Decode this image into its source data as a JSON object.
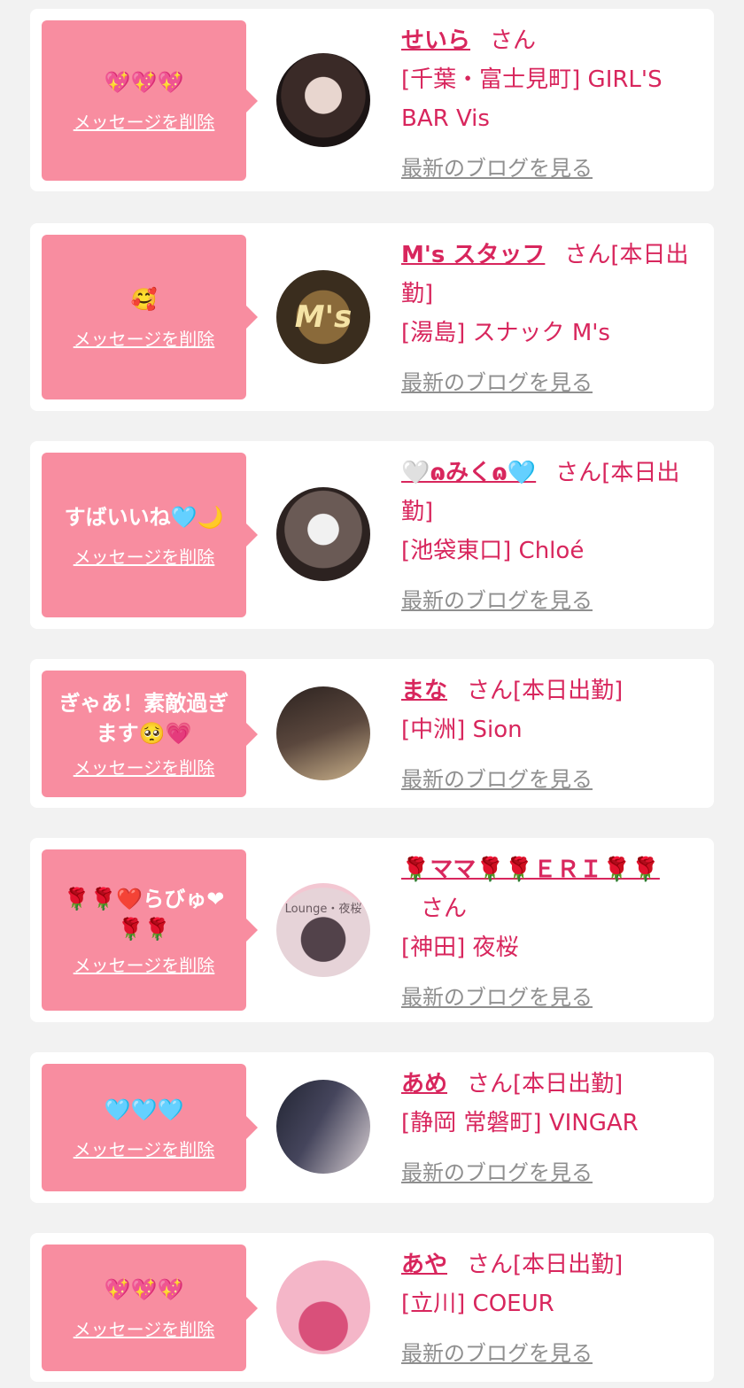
{
  "delete_label": "メッセージを削除",
  "honorific": "さん",
  "blog_label": "最新のブログを見る",
  "colors": {
    "background": "#f2f2f2",
    "card": "#ffffff",
    "bubble": "#f88da0",
    "name_text": "#d8265d",
    "link_gray": "#8f8f8f"
  },
  "entries": [
    {
      "message": "💖💖💖",
      "name": "せいら",
      "suffix": "",
      "shop_line": "[千葉・富士見町] GIRL'S BAR Vis",
      "avatar_icon": "profile-photo",
      "avatar_text": ""
    },
    {
      "message": "🥰",
      "name": "M's スタッフ",
      "suffix": "[本日出勤]",
      "shop_line": "[湯島] スナック M's",
      "avatar_icon": "shop-sign-photo",
      "avatar_text": "M's"
    },
    {
      "message": "すばいいね🩵🌙",
      "name": "🤍ɷみくɷ🩵",
      "suffix": "[本日出勤]",
      "shop_line": "[池袋東口] Chloé",
      "avatar_icon": "profile-photo",
      "avatar_text": ""
    },
    {
      "message": "ぎゃあ！素敵過ぎます🥺💗",
      "name": "まな",
      "suffix": "[本日出勤]",
      "shop_line": "[中洲] Sion",
      "avatar_icon": "profile-photo",
      "avatar_text": ""
    },
    {
      "message": "🌹🌹❤️らびゅ❤🌹🌹",
      "name": "🌹ママ🌹🌹ＥＲＩ🌹🌹",
      "suffix": "",
      "shop_line": "[神田] 夜桜",
      "avatar_icon": "profile-photo",
      "avatar_text": "Lounge・夜桜"
    },
    {
      "message": "🩵🩵🩵",
      "name": "あめ",
      "suffix": "[本日出勤]",
      "shop_line": "[静岡 常磐町] VINGAR",
      "avatar_icon": "profile-photo",
      "avatar_text": ""
    },
    {
      "message": "💖💖💖",
      "name": "あや",
      "suffix": "[本日出勤]",
      "shop_line": "[立川] COEUR",
      "avatar_icon": "profile-photo",
      "avatar_text": ""
    }
  ]
}
